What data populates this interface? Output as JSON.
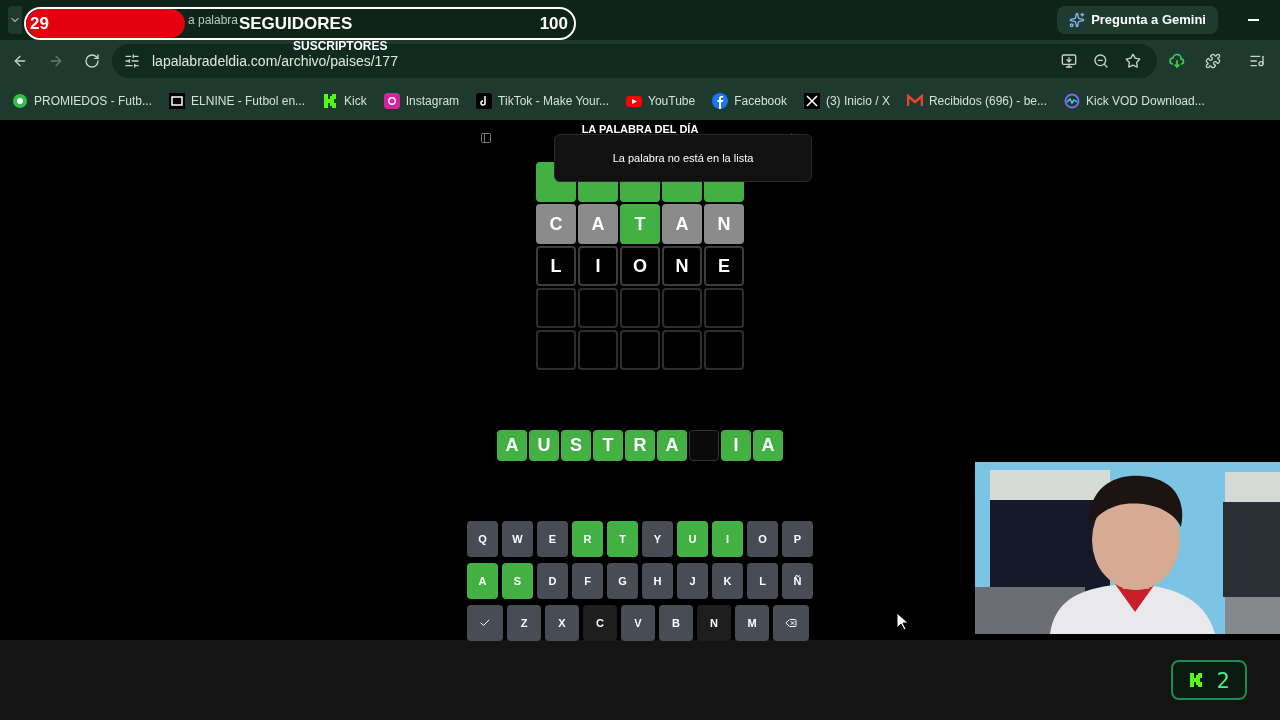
{
  "stream_overlay": {
    "followers": {
      "current": "29",
      "label": "SEGUIDORES",
      "goal": "100",
      "level": 0.29
    },
    "subscribers_label": "SUSCRIPTORES"
  },
  "browser": {
    "tab_title": "a palabra",
    "gemini_button": "Pregunta a Gemini",
    "url": "lapalabradeldia.com/archivo/paises/177",
    "bookmarks": [
      {
        "label": "PROMIEDOS - Futb...",
        "kind": "ball"
      },
      {
        "label": "ELNINE - Futbol en...",
        "kind": "nine"
      },
      {
        "label": "Kick",
        "kind": "kick"
      },
      {
        "label": "Instagram",
        "kind": "instagram"
      },
      {
        "label": "TikTok - Make Your...",
        "kind": "tiktok"
      },
      {
        "label": "YouTube",
        "kind": "youtube"
      },
      {
        "label": "Facebook",
        "kind": "facebook"
      },
      {
        "label": "(3) Inicio / X",
        "kind": "x"
      },
      {
        "label": "Recibidos (696) - be...",
        "kind": "gmail"
      },
      {
        "label": "Kick VOD Download...",
        "kind": "vod"
      }
    ]
  },
  "game": {
    "title": "LA PALABRA DEL DÍA",
    "toast": "La palabra no está en la lista",
    "board": [
      [
        {
          "color": "#43b043"
        },
        {
          "color": "#43b043"
        },
        {
          "color": "#43b043"
        },
        {
          "color": "#43b043"
        },
        {
          "color": "#43b043"
        }
      ],
      [
        {
          "letter": "C",
          "color": "#8b8b8b"
        },
        {
          "letter": "A",
          "color": "#8b8b8b"
        },
        {
          "letter": "T",
          "color": "#43b043"
        },
        {
          "letter": "A",
          "color": "#8b8b8b"
        },
        {
          "letter": "N",
          "color": "#8b8b8b"
        }
      ],
      [
        {
          "letter": "L",
          "color": "#000000"
        },
        {
          "letter": "I",
          "color": "#000000"
        },
        {
          "letter": "O",
          "color": "#000000"
        },
        {
          "letter": "N",
          "color": "#000000"
        },
        {
          "letter": "E",
          "color": "#000000"
        }
      ],
      [
        {
          "color": "#000000"
        },
        {
          "color": "#000000"
        },
        {
          "color": "#000000"
        },
        {
          "color": "#000000"
        },
        {
          "color": "#000000"
        }
      ],
      [
        {
          "color": "#000000"
        },
        {
          "color": "#000000"
        },
        {
          "color": "#000000"
        },
        {
          "color": "#000000"
        },
        {
          "color": "#000000"
        }
      ]
    ],
    "answer": [
      {
        "letter": "A",
        "revealed": true
      },
      {
        "letter": "U",
        "revealed": true
      },
      {
        "letter": "S",
        "revealed": true
      },
      {
        "letter": "T",
        "revealed": true
      },
      {
        "letter": "R",
        "revealed": true
      },
      {
        "letter": "A",
        "revealed": true
      },
      {
        "revealed": false
      },
      {
        "letter": "I",
        "revealed": true
      },
      {
        "letter": "A",
        "revealed": true
      }
    ],
    "keyboard": [
      [
        {
          "key": "Q",
          "color": "#474c55"
        },
        {
          "key": "W",
          "color": "#474c55"
        },
        {
          "key": "E",
          "color": "#474c55"
        },
        {
          "key": "R",
          "color": "#43b043"
        },
        {
          "key": "T",
          "color": "#43b043"
        },
        {
          "key": "Y",
          "color": "#474c55"
        },
        {
          "key": "U",
          "color": "#43b043"
        },
        {
          "key": "I",
          "color": "#43b043"
        },
        {
          "key": "O",
          "color": "#474c55"
        },
        {
          "key": "P",
          "color": "#474c55"
        }
      ],
      [
        {
          "key": "A",
          "color": "#43b043"
        },
        {
          "key": "S",
          "color": "#43b043"
        },
        {
          "key": "D",
          "color": "#474c55"
        },
        {
          "key": "F",
          "color": "#474c55"
        },
        {
          "key": "G",
          "color": "#474c55"
        },
        {
          "key": "H",
          "color": "#474c55"
        },
        {
          "key": "J",
          "color": "#474c55"
        },
        {
          "key": "K",
          "color": "#474c55"
        },
        {
          "key": "L",
          "color": "#474c55"
        },
        {
          "key": "Ñ",
          "color": "#474c55"
        }
      ],
      [
        {
          "kind": "enter",
          "color": "#474c55"
        },
        {
          "key": "Z",
          "color": "#474c55"
        },
        {
          "key": "X",
          "color": "#474c55"
        },
        {
          "key": "C",
          "color": "#1e1e1e"
        },
        {
          "key": "V",
          "color": "#474c55"
        },
        {
          "key": "B",
          "color": "#474c55"
        },
        {
          "key": "N",
          "color": "#1e1e1e"
        },
        {
          "key": "M",
          "color": "#474c55"
        },
        {
          "kind": "backspace",
          "color": "#474c55"
        }
      ]
    ]
  },
  "kick_badge": {
    "count": "2"
  }
}
